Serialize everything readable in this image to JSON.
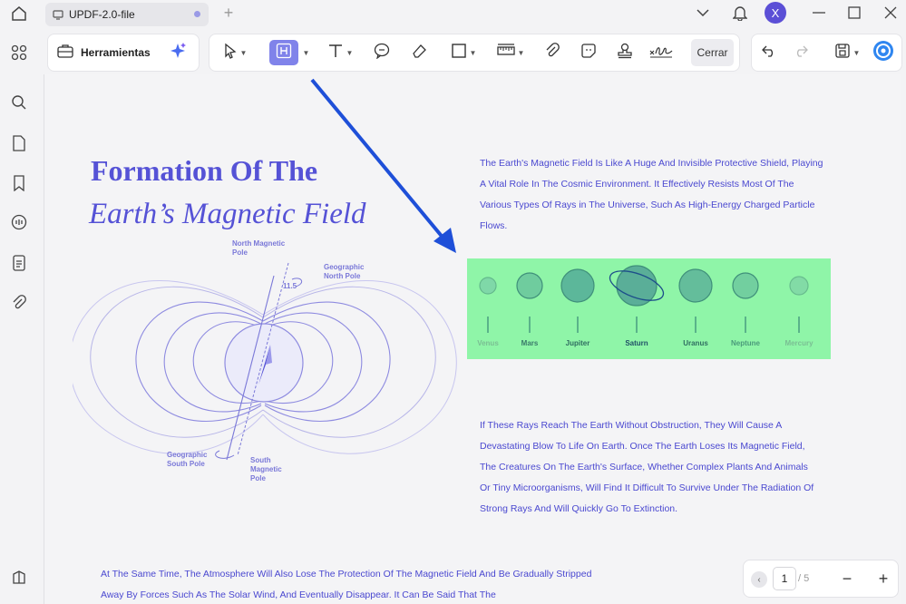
{
  "tab": {
    "title": "UPDF-2.0-file"
  },
  "user": {
    "initial": "X"
  },
  "toolbar": {
    "tools_label": "Herramientas",
    "close_label": "Cerrar"
  },
  "document": {
    "title_line1": "Formation Of The",
    "title_line2": "Earth’s Magnetic Field",
    "para1": "The Earth's Magnetic Field Is Like A Huge And Invisible Protective Shield, Playing A Vital Role In The Cosmic Environment. It Effectively Resists Most Of The Various Types Of Rays in The Universe, Such As High-Energy Charged Particle Flows.",
    "para2": "If These Rays Reach The Earth Without Obstruction, They Will Cause A Devastating Blow To Life On Earth. Once The Earth Loses Its Magnetic Field, The Creatures On The Earth's Surface, Whether Complex Plants And Animals Or Tiny Microorganisms, Will Find It Difficult To Survive Under The Radiation Of Strong Rays And Will Quickly Go To Extinction.",
    "para3": "At The Same Time, The Atmosphere Will Also Lose The Protection Of The Magnetic Field And Be Gradually Stripped Away By Forces Such As The Solar Wind, And Eventually Disappear. It Can Be Said That The",
    "planets": [
      "Venus",
      "Mars",
      "Jupiter",
      "Saturn",
      "Uranus",
      "Neptune",
      "Mercury"
    ],
    "highlight_color": "#8ff5a8",
    "diagram": {
      "north_magnetic_pole": "North Magnetic Pole",
      "geographic_north_pole": "Geographic North Pole",
      "geographic_south_pole": "Geographic South Pole",
      "south_magnetic_pole": "South Magnetic Pole",
      "tilt": "11.5"
    }
  },
  "pager": {
    "current": "1",
    "total": "/ 5"
  },
  "colors": {
    "accent": "#5552d6",
    "arrow": "#1e4fd8"
  }
}
